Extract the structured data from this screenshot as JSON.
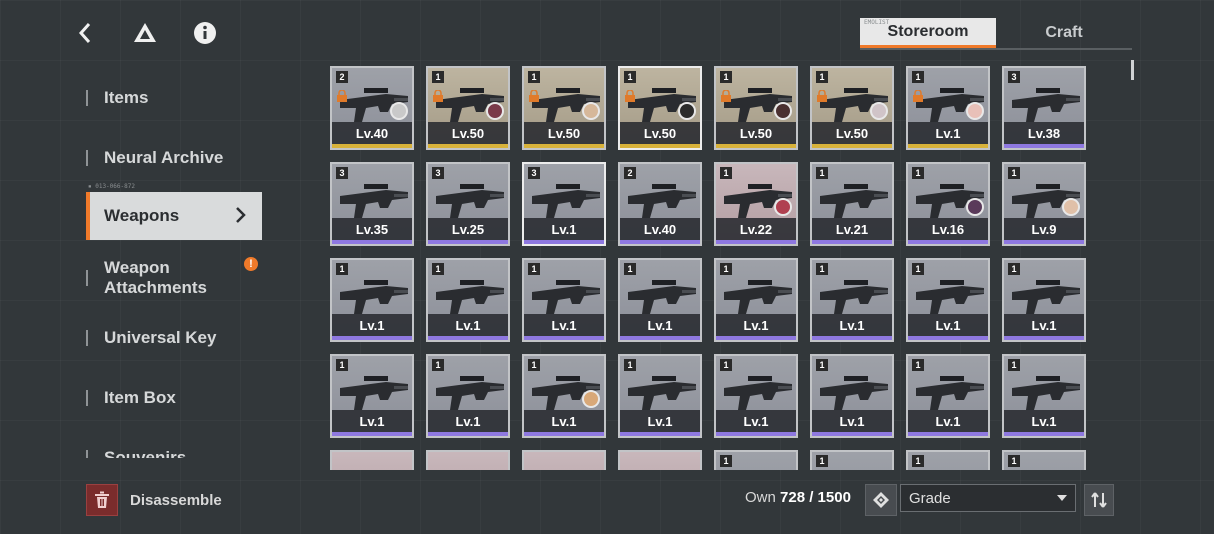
{
  "tabs": [
    {
      "label": "Storeroom",
      "active": true
    },
    {
      "label": "Craft",
      "active": false
    }
  ],
  "tab_small": "EMOLIST",
  "sidebar": {
    "items": [
      {
        "label": "Items"
      },
      {
        "label": "Neural Archive"
      },
      {
        "label": "Weapons",
        "active": true
      },
      {
        "label": "Weapon Attachments",
        "warning": "!"
      },
      {
        "label": "Universal Key"
      },
      {
        "label": "Item Box"
      },
      {
        "label": "Souvenirs"
      }
    ],
    "tiny_code": "▪ 013-066-872"
  },
  "colors": {
    "accent": "#f07a2a",
    "gold_rarity": "#d8b23a",
    "purple_rarity": "#8e78e0"
  },
  "weapons": [
    {
      "rank": "2",
      "level": "Lv.40",
      "locked": true,
      "portrait": "#c9c9c9",
      "rarity": "gold",
      "bg": "normal"
    },
    {
      "rank": "1",
      "level": "Lv.50",
      "locked": true,
      "portrait": "#7a3a4a",
      "rarity": "gold",
      "bg": "tan"
    },
    {
      "rank": "1",
      "level": "Lv.50",
      "locked": true,
      "portrait": "#d6b89a",
      "rarity": "gold",
      "bg": "tan"
    },
    {
      "rank": "1",
      "level": "Lv.50",
      "locked": true,
      "portrait": "#2b2b2b",
      "rarity": "gold",
      "bg": "tan",
      "selected": true
    },
    {
      "rank": "1",
      "level": "Lv.50",
      "locked": true,
      "portrait": "#4a3030",
      "rarity": "gold",
      "bg": "tan"
    },
    {
      "rank": "1",
      "level": "Lv.50",
      "locked": true,
      "portrait": "#d0c4c8",
      "rarity": "gold",
      "bg": "tan"
    },
    {
      "rank": "1",
      "level": "Lv.1",
      "locked": true,
      "portrait": "#e8c0b8",
      "rarity": "gold",
      "bg": "normal"
    },
    {
      "rank": "3",
      "level": "Lv.38",
      "locked": false,
      "portrait": null,
      "rarity": "purple",
      "bg": "normal"
    },
    {
      "rank": "3",
      "level": "Lv.35",
      "locked": false,
      "portrait": null,
      "rarity": "purple",
      "bg": "normal"
    },
    {
      "rank": "3",
      "level": "Lv.25",
      "locked": false,
      "portrait": null,
      "rarity": "purple",
      "bg": "normal"
    },
    {
      "rank": "3",
      "level": "Lv.1",
      "locked": false,
      "portrait": null,
      "rarity": "purple",
      "bg": "normal",
      "selected": true
    },
    {
      "rank": "2",
      "level": "Lv.40",
      "locked": false,
      "portrait": null,
      "rarity": "purple",
      "bg": "normal"
    },
    {
      "rank": "1",
      "level": "Lv.22",
      "locked": false,
      "portrait": "#b04050",
      "rarity": "purple",
      "bg": "pink"
    },
    {
      "rank": "1",
      "level": "Lv.21",
      "locked": false,
      "portrait": null,
      "rarity": "purple",
      "bg": "normal"
    },
    {
      "rank": "1",
      "level": "Lv.16",
      "locked": false,
      "portrait": "#5a3a5a",
      "rarity": "purple",
      "bg": "normal"
    },
    {
      "rank": "1",
      "level": "Lv.9",
      "locked": false,
      "portrait": "#e0c0a8",
      "rarity": "purple",
      "bg": "normal"
    },
    {
      "rank": "1",
      "level": "Lv.1",
      "rarity": "purple",
      "bg": "normal"
    },
    {
      "rank": "1",
      "level": "Lv.1",
      "rarity": "purple",
      "bg": "normal"
    },
    {
      "rank": "1",
      "level": "Lv.1",
      "rarity": "purple",
      "bg": "normal"
    },
    {
      "rank": "1",
      "level": "Lv.1",
      "rarity": "purple",
      "bg": "normal"
    },
    {
      "rank": "1",
      "level": "Lv.1",
      "rarity": "purple",
      "bg": "normal"
    },
    {
      "rank": "1",
      "level": "Lv.1",
      "rarity": "purple",
      "bg": "normal"
    },
    {
      "rank": "1",
      "level": "Lv.1",
      "rarity": "purple",
      "bg": "normal"
    },
    {
      "rank": "1",
      "level": "Lv.1",
      "rarity": "purple",
      "bg": "normal"
    },
    {
      "rank": "1",
      "level": "Lv.1",
      "rarity": "purple",
      "bg": "normal"
    },
    {
      "rank": "1",
      "level": "Lv.1",
      "rarity": "purple",
      "bg": "normal"
    },
    {
      "rank": "1",
      "level": "Lv.1",
      "rarity": "purple",
      "bg": "normal",
      "portrait": "#d8a878"
    },
    {
      "rank": "1",
      "level": "Lv.1",
      "rarity": "purple",
      "bg": "normal"
    },
    {
      "rank": "1",
      "level": "Lv.1",
      "rarity": "purple",
      "bg": "normal"
    },
    {
      "rank": "1",
      "level": "Lv.1",
      "rarity": "purple",
      "bg": "normal"
    },
    {
      "rank": "1",
      "level": "Lv.1",
      "rarity": "purple",
      "bg": "normal"
    },
    {
      "rank": "1",
      "level": "Lv.1",
      "rarity": "purple",
      "bg": "normal"
    },
    {
      "rank": "",
      "level": "",
      "rarity": "purple",
      "bg": "pink"
    },
    {
      "rank": "",
      "level": "",
      "rarity": "purple",
      "bg": "pink"
    },
    {
      "rank": "",
      "level": "",
      "rarity": "purple",
      "bg": "pink"
    },
    {
      "rank": "",
      "level": "",
      "rarity": "purple",
      "bg": "pink"
    },
    {
      "rank": "1",
      "level": "",
      "rarity": "purple",
      "bg": "normal"
    },
    {
      "rank": "1",
      "level": "",
      "rarity": "purple",
      "bg": "normal"
    },
    {
      "rank": "1",
      "level": "",
      "rarity": "purple",
      "bg": "normal"
    },
    {
      "rank": "1",
      "level": "",
      "rarity": "purple",
      "bg": "normal"
    }
  ],
  "footer": {
    "disassemble_label": "Disassemble",
    "own_label": "Own",
    "own_value": "728 / 1500",
    "sort_value": "Grade"
  }
}
